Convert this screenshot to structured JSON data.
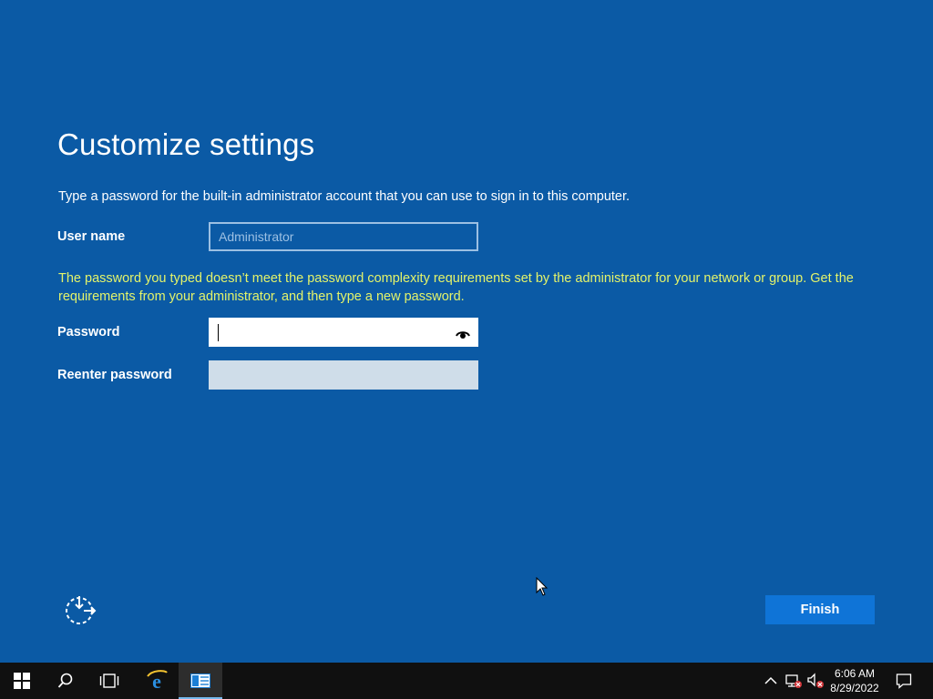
{
  "page": {
    "title": "Customize settings",
    "intro": "Type a password for the built-in administrator account that you can use to sign in to this computer.",
    "warning": "The password you typed doesn’t meet the password complexity requirements set by the administrator for your network or group. Get the requirements from your administrator, and then type a new password."
  },
  "form": {
    "username_label": "User name",
    "username_value": "Administrator",
    "password_label": "Password",
    "password_value": "",
    "reenter_label": "Reenter password",
    "reenter_value": ""
  },
  "actions": {
    "finish_label": "Finish",
    "accessibility_icon": "ease-of-access-icon"
  },
  "taskbar": {
    "items": [
      "start-icon",
      "search-icon",
      "task-view-icon",
      "internet-explorer-icon",
      "server-setup-app-icon"
    ],
    "tray": [
      "show-hidden-icons-chevron",
      "network-disconnected-icon",
      "volume-muted-icon",
      "action-center-icon"
    ],
    "time": "6:06 AM",
    "date": "8/29/2022"
  },
  "colors": {
    "background": "#0b5aa5",
    "warning_text": "#e3f36a",
    "finish_button": "#0f74d7",
    "taskbar": "#101010"
  }
}
